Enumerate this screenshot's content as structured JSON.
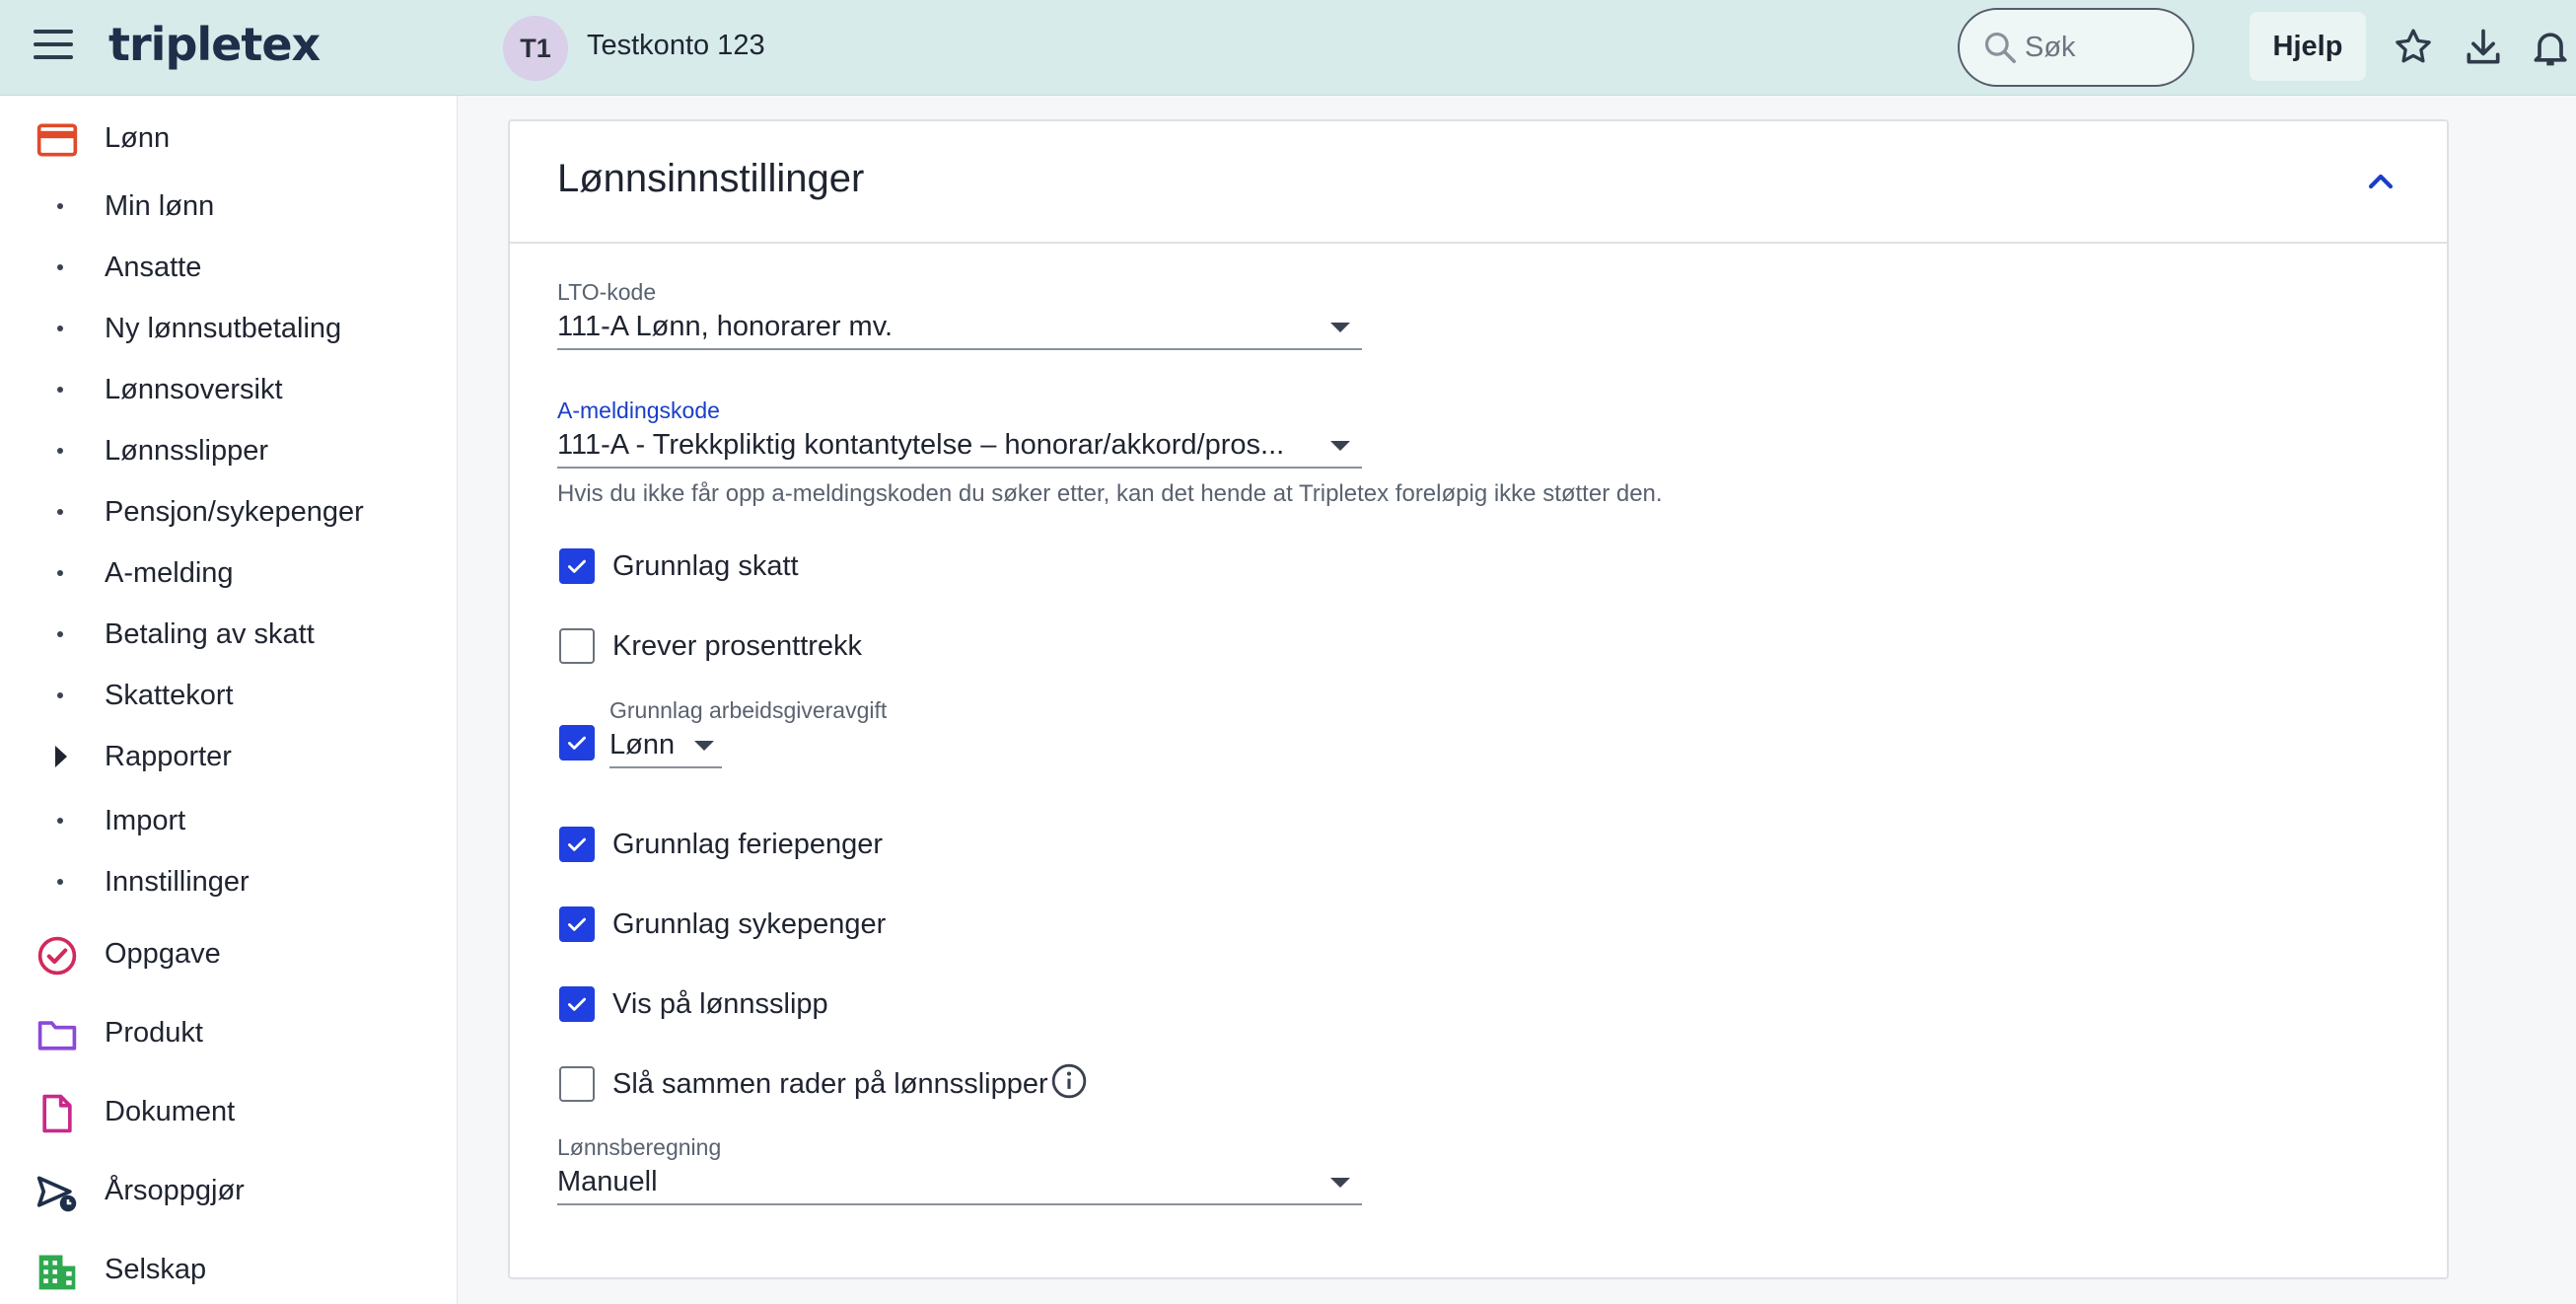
{
  "header": {
    "logo": "tripletex",
    "avatar_initials": "T1",
    "company_name": "Testkonto 123",
    "search_placeholder": "Søk",
    "help_label": "Hjelp"
  },
  "sidebar": {
    "sections": [
      {
        "label": "Lønn",
        "icon": "payroll-card-icon"
      },
      {
        "label": "Oppgave",
        "icon": "task-check-icon"
      },
      {
        "label": "Produkt",
        "icon": "folder-icon"
      },
      {
        "label": "Dokument",
        "icon": "document-icon"
      },
      {
        "label": "Årsoppgjør",
        "icon": "annual-report-icon"
      },
      {
        "label": "Selskap",
        "icon": "company-building-icon"
      }
    ],
    "sub_items": [
      "Min lønn",
      "Ansatte",
      "Ny lønnsutbetaling",
      "Lønnsoversikt",
      "Lønnsslipper",
      "Pensjon/sykepenger",
      "A-melding",
      "Betaling av skatt",
      "Skattekort",
      "Rapporter",
      "Import",
      "Innstillinger"
    ]
  },
  "card": {
    "title": "Lønnsinnstillinger",
    "lto_label": "LTO-kode",
    "lto_value": "111-A Lønn, honorarer mv.",
    "amelding_label": "A-meldingskode",
    "amelding_value": "111-A - Trekkpliktig kontantytelse – honorar/akkord/pros...",
    "amelding_helper": "Hvis du ikke får opp a-meldingskoden du søker etter, kan det hende at Tripletex foreløpig ikke støtter den.",
    "checkboxes": [
      {
        "label": "Grunnlag skatt",
        "checked": true
      },
      {
        "label": "Krever prosenttrekk",
        "checked": false
      },
      {
        "label": "Grunnlag feriepenger",
        "checked": true
      },
      {
        "label": "Grunnlag sykepenger",
        "checked": true
      },
      {
        "label": "Vis på lønnsslipp",
        "checked": true
      },
      {
        "label": "Slå sammen rader på lønnsslipper",
        "checked": false
      }
    ],
    "aga": {
      "checked": true,
      "label": "Grunnlag arbeidsgiveravgift",
      "value": "Lønn"
    },
    "calc_label": "Lønnsberegning",
    "calc_value": "Manuell"
  },
  "colors": {
    "topbar": "#d6ebea",
    "accent": "#1f3fe0",
    "active_label": "#1a3ec8"
  }
}
